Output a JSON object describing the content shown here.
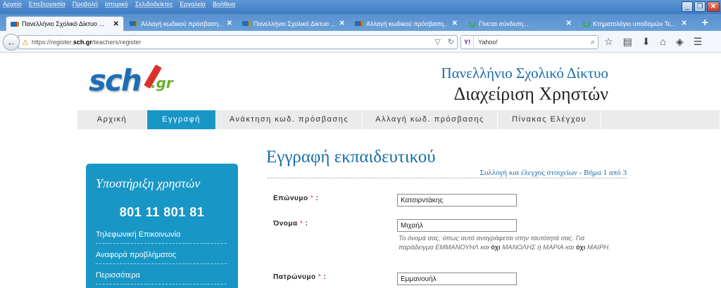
{
  "menubar": {
    "items": [
      "Αρχείο",
      "Επεξεργασία",
      "Προβολή",
      "Ιστορικό",
      "Σελιδοδείκτες",
      "Εργαλεία",
      "Βοήθεια"
    ]
  },
  "tabs": [
    {
      "label": "Πανελλήνιο Σχολικό Δίκτυο ...",
      "icon": "sch-favicon",
      "active": true
    },
    {
      "label": "Αλλαγή κωδικού πρόσβαση...",
      "icon": "sch-favicon",
      "active": false
    },
    {
      "label": "Πανελλήνιο Σχολικό Δίκτυο ...",
      "icon": "sch-favicon",
      "active": false
    },
    {
      "label": "Αλλαγή κωδικού πρόσβαση...",
      "icon": "sch-favicon",
      "active": false
    },
    {
      "label": "Γίνεται σύνδεση...",
      "icon": "loading-spinner-icon",
      "active": false
    },
    {
      "label": "Κτηματολόγιο υποδομών Τε...",
      "icon": "loading-spinner-icon",
      "active": false
    }
  ],
  "navbar": {
    "url_prefix": "https://register.",
    "url_domain": "sch.gr",
    "url_path": "/teachers/register",
    "search_engine": "Y!",
    "search_placeholder": "Yahoo!"
  },
  "header": {
    "logo_text": "sch",
    "logo_suffix": ".gr",
    "title_line1": "Πανελλήνιο Σχολικό Δίκτυο",
    "title_line2": "Διαχείριση Χρηστών"
  },
  "mainnav": {
    "items": [
      {
        "label": "Αρχική",
        "active": false
      },
      {
        "label": "Εγγραφή",
        "active": true
      },
      {
        "label": "Ανάκτηση κωδ. πρόσβασης",
        "active": false
      },
      {
        "label": "Αλλαγή κωδ. πρόσβασης",
        "active": false
      },
      {
        "label": "Πίνακας Ελέγχου",
        "active": false
      }
    ]
  },
  "sidebar": {
    "title": "Υποστήριξη χρηστών",
    "phone": "801 11 801 81",
    "links": [
      "Τηλεφωνική Επικοινωνία",
      "Αναφορά προβλήματος",
      "Περισσότερα"
    ]
  },
  "form": {
    "title": "Εγγραφή εκπαιδευτικού",
    "step": "Συλλογή και έλεγχος στοιχείων - Βήμα 1 από 3",
    "required_mark": "*",
    "fields": [
      {
        "label": "Επώνυμο",
        "value": "Κατσιρντάκης"
      },
      {
        "label": "Όνομα",
        "value": "Μιχαήλ"
      },
      {
        "label": "Πατρώνυμο",
        "value": "Εμμανουήλ"
      }
    ],
    "help": {
      "part1": "Το όνομά σας, όπως αυτό αναγράφεται στην ταυτότητά σας. Για παράδειγμα ΕΜΜΑΝΟΥΗΛ και ",
      "not1": "όχι",
      "part2": " ΜΑΝΟΛΗΣ ή ΜΑΡΙΑ και ",
      "not2": "όχι",
      "part3": " ΜΑΙΡΗ."
    }
  },
  "colors": {
    "brand_blue": "#1896c6",
    "title_blue": "#1a6ea8",
    "required_red": "#d9322b"
  }
}
